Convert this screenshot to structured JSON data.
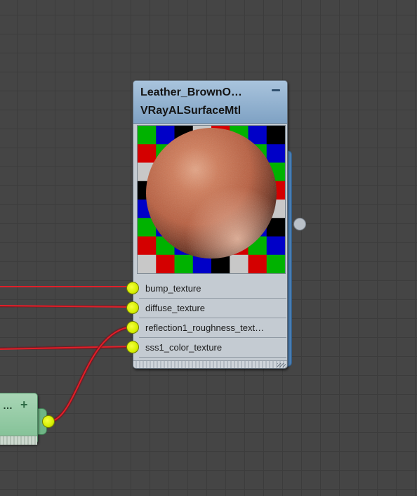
{
  "canvas": {
    "background_color": "#454545",
    "grid_color": "#3c3c3c",
    "wire_color": "#e0202a"
  },
  "material_node": {
    "title": "Leather_BrownO…",
    "type": "VRayALSurfaceMtl",
    "header_color": "#8fb0cf",
    "input_slots": [
      {
        "label": "bump_texture"
      },
      {
        "label": "diffuse_texture"
      },
      {
        "label": "reflection1_roughness_text…"
      },
      {
        "label": "sss1_color_texture"
      }
    ],
    "preview": {
      "sphere_color": "#c06848",
      "checker_colors": [
        "#00b200",
        "#0000c8",
        "#000000",
        "#c8c8c8",
        "#d40000"
      ]
    },
    "icons": [
      "minimize-icon",
      "resize-grip-icon"
    ]
  },
  "map_node": {
    "title": "…",
    "add_label": "+",
    "color": "#8fc7a0"
  }
}
